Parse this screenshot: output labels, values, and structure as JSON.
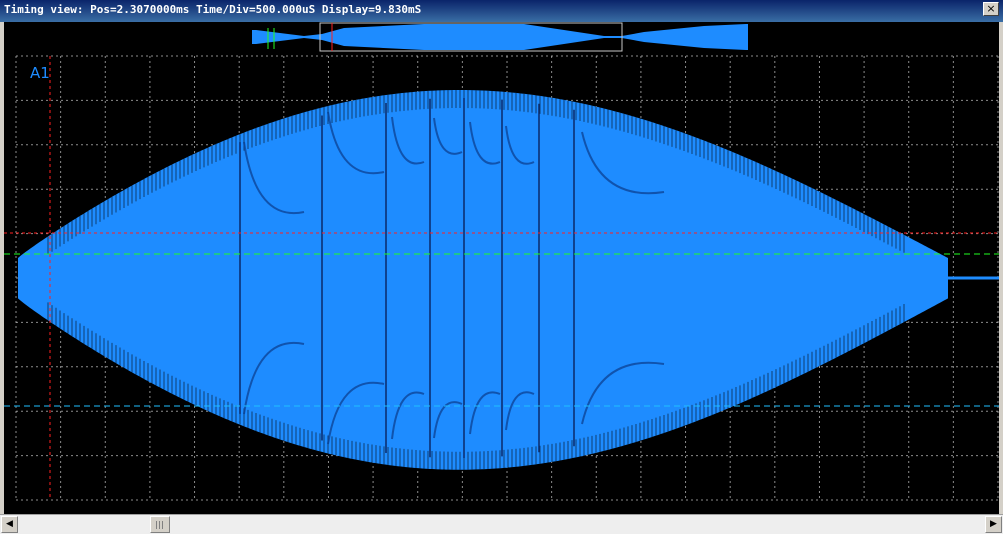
{
  "window": {
    "title": "Timing view: Pos=2.3070000ms Time/Div=500.000uS Display=9.830mS",
    "close_label": "×"
  },
  "scope": {
    "channel_label": "A1",
    "position_ms": 2.307,
    "time_per_div_us": 500,
    "display_ms": 9.83,
    "trace_color": "#1e8cff",
    "background": "#000000",
    "grid_color": "#c8c8c8",
    "cursor_colors": {
      "vertical": "#ff2020",
      "horizontal_top": "#ff2020",
      "horizontal_mid": "#20ff20",
      "horizontal_bottom": "#20c0ff"
    }
  },
  "overview": {
    "viewport_start_fraction": 0.14,
    "viewport_end_fraction": 0.74
  },
  "scrollbar": {
    "left_arrow": "◀",
    "right_arrow": "▶",
    "thumb_position_fraction": 0.15
  }
}
